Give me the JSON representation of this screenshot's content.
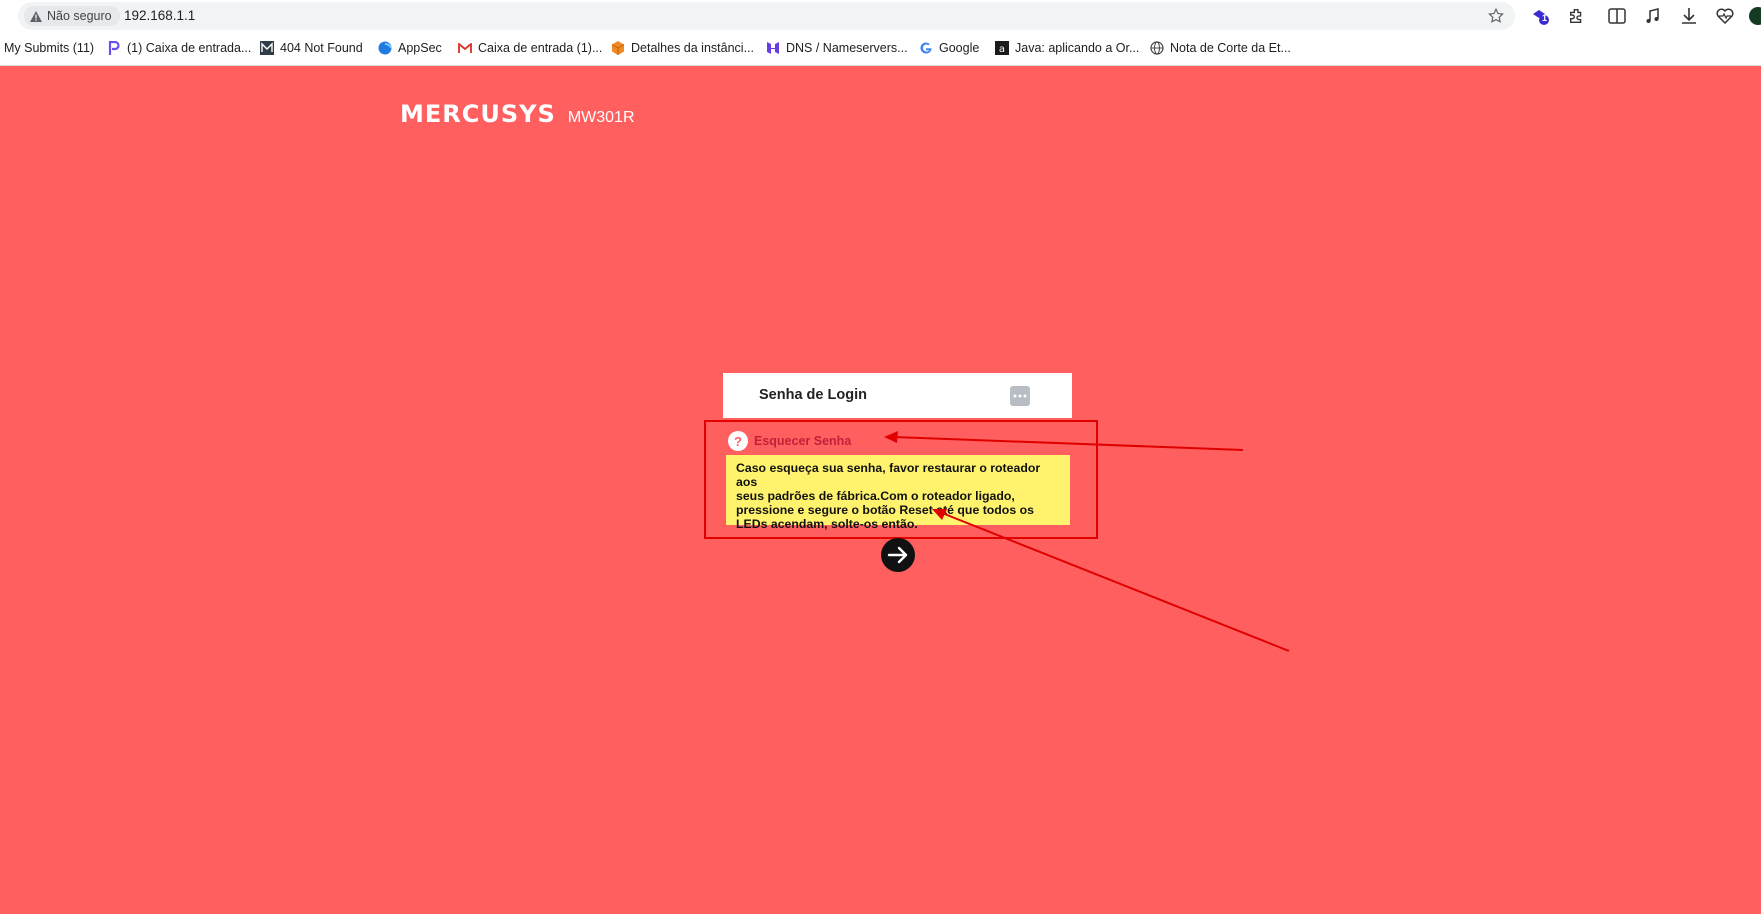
{
  "browser": {
    "security_label": "Não seguro",
    "url": "192.168.1.1",
    "extension_badge": "1",
    "bookmarks": [
      {
        "label": "My Submits (11)",
        "icon": "none"
      },
      {
        "label": "(1) Caixa de entrada...",
        "icon": "p-logo-icon"
      },
      {
        "label": "404 Not Found",
        "icon": "m-logo-icon"
      },
      {
        "label": "AppSec",
        "icon": "drop-icon"
      },
      {
        "label": "Caixa de entrada (1)...",
        "icon": "gmail-icon"
      },
      {
        "label": "Detalhes da instânci...",
        "icon": "cube-icon"
      },
      {
        "label": "DNS / Nameservers...",
        "icon": "hostinger-icon"
      },
      {
        "label": "Google",
        "icon": "google-icon"
      },
      {
        "label": "Java: aplicando a Or...",
        "icon": "a-logo-icon"
      },
      {
        "label": "Nota de Corte da Et...",
        "icon": "globe-icon"
      }
    ]
  },
  "page": {
    "brand": "MERCUSYS",
    "model": "MW301R",
    "login_label": "Senha de Login",
    "forgot_help_glyph": "?",
    "forgot_link": "Esquecer Senha",
    "tooltip_lines": [
      "Caso esqueça sua senha, favor restaurar o roteador aos",
      "seus padrões de fábrica.Com o roteador ligado,",
      "pressione e segure o botão Reset até que todos os",
      "LEDs acendam, solte-os então."
    ]
  },
  "colors": {
    "background": "#ff5f5f",
    "tooltip": "#fff36e",
    "annotation": "#e00000",
    "forgot_link": "#c0223a"
  }
}
